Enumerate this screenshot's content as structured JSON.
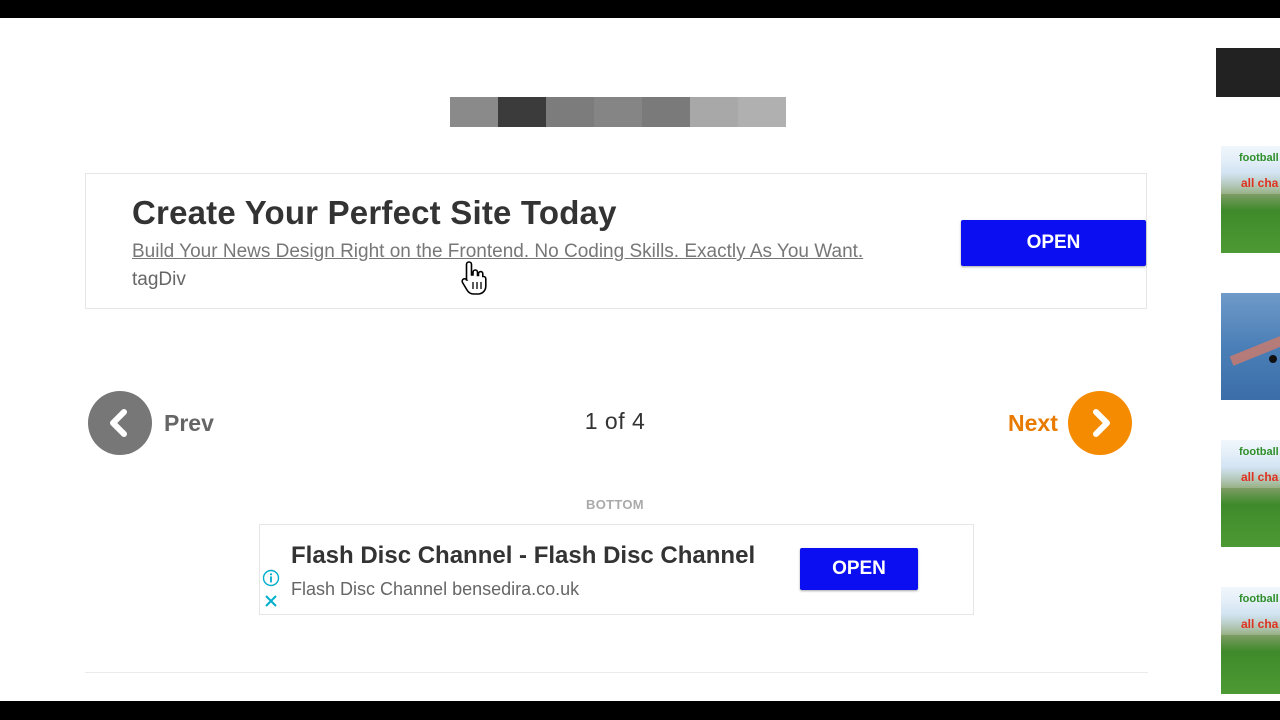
{
  "top_ad": {
    "headline": "Create Your Perfect Site Today",
    "description": "Build Your News Design Right on the Frontend. No Coding Skills. Exactly As You Want.",
    "brand": "tagDiv",
    "button_label": "OPEN"
  },
  "pagination": {
    "prev_label": "Prev",
    "next_label": "Next",
    "page_indicator": "1 of 4"
  },
  "bottom_section_label": "BOTTOM",
  "bottom_ad": {
    "headline": "Flash Disc Channel - Flash Disc Channel",
    "sub_text": "Flash Disc Channel bensedira.co.uk",
    "button_label": "OPEN",
    "info_icon": "info-icon",
    "close_icon": "close-icon"
  },
  "sidebar_thumbs": [
    {
      "line1": "football ",
      "line2": "all cha"
    },
    {},
    {
      "line1": "football ",
      "line2": "all cha"
    },
    {
      "line1": "football ",
      "line2": "all cha"
    }
  ],
  "colors": {
    "button_blue": "#0a0ef0",
    "next_orange": "#f58b00",
    "prev_gray": "#777777"
  }
}
